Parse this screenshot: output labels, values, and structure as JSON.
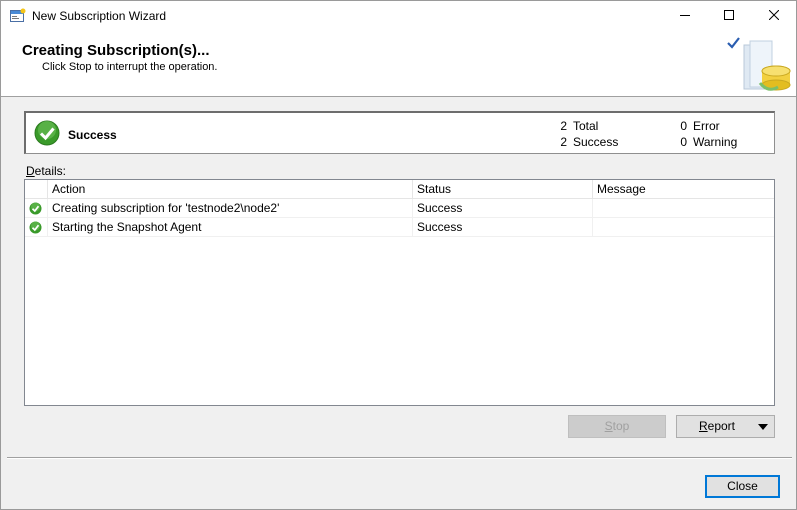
{
  "window": {
    "title": "New Subscription Wizard",
    "app_icon": "wizard-app-icon",
    "controls": {
      "minimize_icon": "minimize-icon",
      "maximize_icon": "maximize-icon",
      "close_icon": "close-icon"
    }
  },
  "header": {
    "title": "Creating Subscription(s)...",
    "subtitle": "Click Stop to interrupt the operation.",
    "graphic": "wizard-database-graphic"
  },
  "summary": {
    "status_icon": "success-check-icon",
    "status_label": "Success",
    "total_count": "2",
    "total_label": "Total",
    "success_count": "2",
    "success_label": "Success",
    "error_count": "0",
    "error_label": "Error",
    "warning_count": "0",
    "warning_label": "Warning"
  },
  "details": {
    "label_mnemonic": "D",
    "label_rest": "etails:",
    "columns": [
      "Action",
      "Status",
      "Message"
    ],
    "rows": [
      {
        "icon": "success-check-icon",
        "action": "Creating subscription for 'testnode2\\node2'",
        "status": "Success",
        "message": ""
      },
      {
        "icon": "success-check-icon",
        "action": "Starting the Snapshot Agent",
        "status": "Success",
        "message": ""
      }
    ]
  },
  "buttons": {
    "stop_mnemonic": "S",
    "stop_rest": "top",
    "report_mnemonic": "R",
    "report_rest": "eport",
    "close": "Close"
  },
  "colors": {
    "accent_blue": "#0078d7",
    "success_green": "#3a9a2a"
  }
}
